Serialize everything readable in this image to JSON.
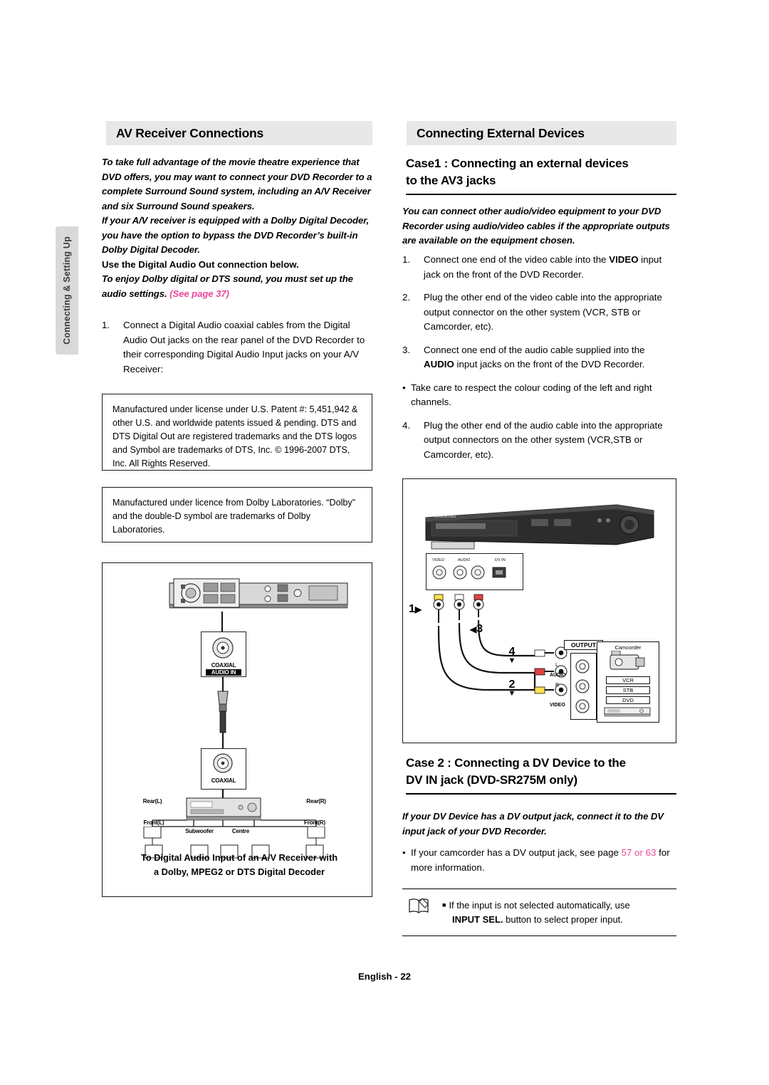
{
  "sidebar": {
    "tab_label": "Connecting & Setting Up"
  },
  "left": {
    "heading": "AV Receiver Connections",
    "intro": "To take full advantage of the movie theatre experience that DVD offers, you may want to connect your DVD Recorder to a complete Surround Sound system, including an A/V Receiver and six Surround Sound speakers.",
    "intro2": "If your A/V receiver is equipped with a Dolby Digital Decoder, you have the option to bypass the DVD Recorder’s built-in Dolby Digital Decoder.",
    "intro3": "Use the Digital Audio Out connection below.",
    "intro4_a": "To enjoy Dolby digital or DTS sound, you must set up the audio settings. ",
    "intro4_link": "(See page 37)",
    "step1_num": "1.",
    "step1_text": "Connect a Digital Audio coaxial cables from the Digital Audio Out jacks on the rear panel of the DVD Recorder to their corresponding Digital Audio Input jacks on your A/V Receiver:",
    "dts_box": "Manufactured under license under U.S. Patent #: 5,451,942 & other U.S. and worldwide patents issued & pending. DTS and DTS Digital Out are registered trademarks and the DTS logos and Symbol are trademarks of DTS, Inc. © 1996-2007 DTS, Inc. All Rights Reserved.",
    "dolby_box": "Manufactured under licence from Dolby Laboratories. “Dolby” and the double-D symbol are trademarks of Dolby Laboratories.",
    "diagram": {
      "coaxial_top_line1": "COAXIAL",
      "coaxial_top_line2": "AUDIO IN",
      "coaxial_bottom": "COAXIAL",
      "speaker_rear_l": "Rear(L)",
      "speaker_rear_r": "Rear(R)",
      "speaker_front_l": "Front(L)",
      "speaker_front_r": "Front(R)",
      "speaker_subwoofer": "Subwoofer",
      "speaker_centre": "Centre",
      "caption_line1": "To Digital Audio Input of an A/V Receiver with",
      "caption_line2": "a Dolby, MPEG2 or DTS Digital Decoder"
    }
  },
  "right": {
    "heading": "Connecting External Devices",
    "case1_title_line1": "Case1 : Connecting an external devices",
    "case1_title_line2": "to the AV3 jacks",
    "case1_intro": "You can connect other audio/video equipment to your DVD Recorder using audio/video cables if the appropriate outputs are available on the equipment chosen.",
    "steps": [
      {
        "num": "1.",
        "pre": "Connect one end of the video cable into the ",
        "bold": "VIDEO",
        "post": " input jack on the front of the DVD Recorder."
      },
      {
        "num": "2.",
        "pre": "Plug the other end of the video cable into the appropriate output connector on the other system (VCR, STB or Camcorder, etc).",
        "bold": "",
        "post": ""
      },
      {
        "num": "3.",
        "pre": "Connect one end of the audio cable supplied into the ",
        "bold": "AUDIO",
        "post": " input jacks on the front of the DVD Recorder."
      }
    ],
    "bullet1": "Take care to respect the colour coding of the left and right channels.",
    "step4": {
      "num": "4.",
      "text": "Plug the other end of the audio cable into the appropriate output connectors on the other system (VCR,STB or Camcorder, etc)."
    },
    "diagram": {
      "brand": "SAMSUNG",
      "jack_video": "VIDEO",
      "jack_audio": "AUDIO",
      "jack_dv": "DV IN",
      "callout_1": "1",
      "callout_3": "3",
      "callout_4": "4",
      "callout_2": "2",
      "output_label": "OUTPUT",
      "camcorder": "Camcorder",
      "audio_label": "AUDIO",
      "video_label": "VIDEO",
      "dev_vcr": "VCR",
      "dev_stb": "STB",
      "dev_dvd": "DVD",
      "lr_l": "L",
      "lr_r": "R"
    },
    "case2_title_line1": "Case 2 : Connecting a DV Device to the",
    "case2_title_line2": "DV IN jack (DVD-SR275M only)",
    "case2_intro": "If your DV Device has a DV output jack, connect it to the DV input jack of your DVD Recorder.",
    "case2_bullet_pre": "If your camcorder has a DV output jack, see page ",
    "case2_bullet_link": "57 or 63",
    "case2_bullet_post": " for more information.",
    "note_line1": "If the input is not selected automatically, use",
    "note_bold": "INPUT SEL.",
    "note_line2": " button to select proper input."
  },
  "footer": {
    "text": "English - 22"
  }
}
